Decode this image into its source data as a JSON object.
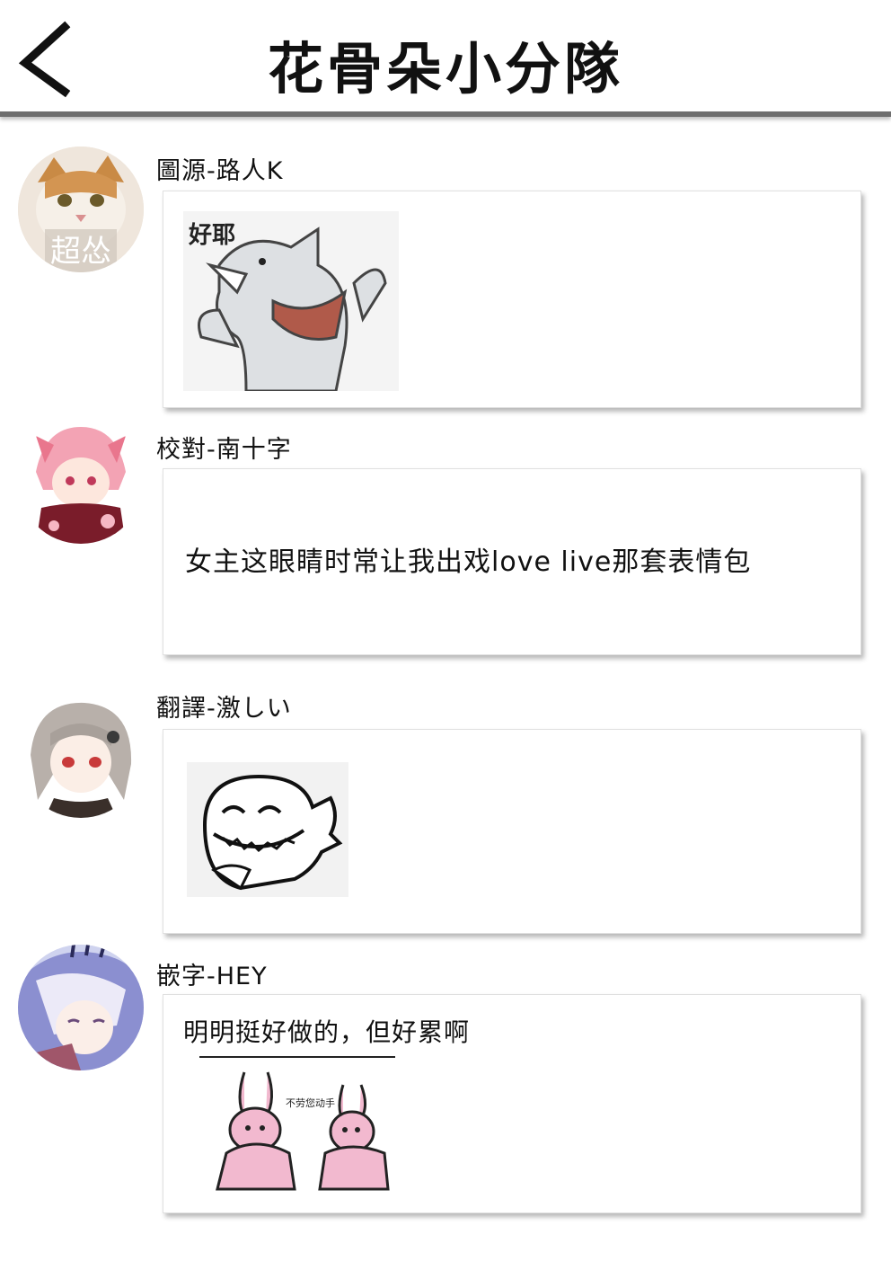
{
  "header": {
    "title": "花骨朵小分隊",
    "back_icon": "chevron-left-icon"
  },
  "posts": [
    {
      "author": "圖源-路人K",
      "avatar": "cat-avatar",
      "avatar_overlay_text": "超怂",
      "sticker": "dog-sticker",
      "sticker_caption": "好耶"
    },
    {
      "author": "校對-南十字",
      "avatar": "pink-hair-anime-avatar",
      "message": "女主这眼睛时常让我出戏love live那套表情包"
    },
    {
      "author": "翻譯-激しい",
      "avatar": "grey-hair-anime-avatar",
      "sticker": "laughing-dino-sticker"
    },
    {
      "author": "嵌字-HEY",
      "avatar": "purple-hair-anime-avatar",
      "message": "明明挺好做的，但好累啊",
      "sticker": "rabbits-sticker",
      "sticker_caption": "不劳您动手"
    }
  ]
}
